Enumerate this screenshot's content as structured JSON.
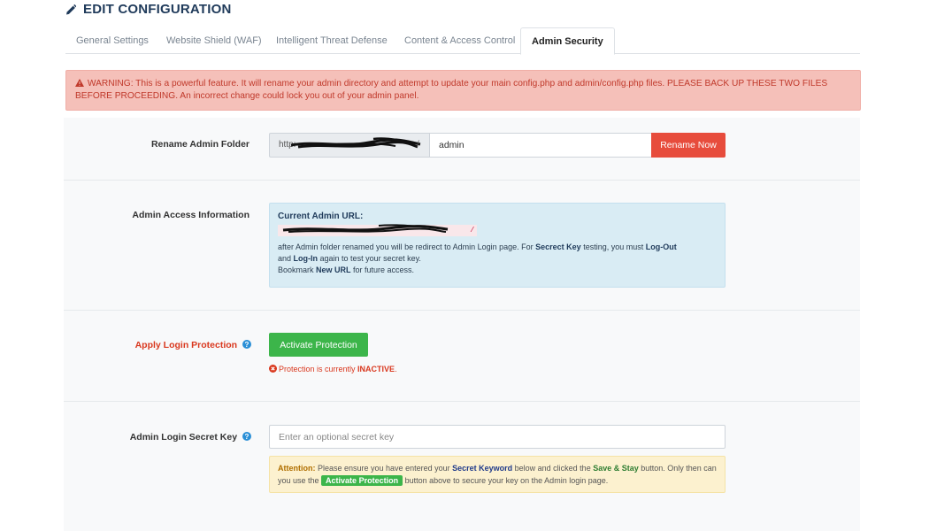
{
  "header": {
    "title": "EDIT CONFIGURATION",
    "icon": "pencil-icon"
  },
  "tabs": [
    {
      "label": "General Settings",
      "active": false
    },
    {
      "label": "Website Shield (WAF)",
      "active": false
    },
    {
      "label": "Intelligent Threat Defense",
      "active": false
    },
    {
      "label": "Content & Access Control",
      "active": false
    },
    {
      "label": "Admin Security",
      "active": true
    }
  ],
  "warning": {
    "text": "WARNING: This is a powerful feature. It will rename your admin directory and attempt to update your main config.php and admin/config.php files. PLEASE BACK UP THESE TWO FILES BEFORE PROCEEDING. An incorrect change could lock you out of your admin panel."
  },
  "rename_folder": {
    "label": "Rename Admin Folder",
    "url_prefix": "http:",
    "url_suffix": "/",
    "input_value": "admin",
    "button_label": "Rename Now"
  },
  "access_info": {
    "label": "Admin Access Information",
    "title": "Current Admin URL:",
    "url_tail": "/",
    "line1_a": "after Admin folder renamed you will be redirect to Admin Login page. For ",
    "line1_b": "Secrect Key",
    "line1_c": " testing, you must ",
    "line1_d": "Log-Out",
    "line2_a": "and ",
    "line2_b": "Log-In",
    "line2_c": " again to test your secret key.",
    "line3_a": "Bookmark ",
    "line3_b": "New URL",
    "line3_c": " for future access."
  },
  "login_protection": {
    "label": "Apply Login Protection",
    "button_label": "Activate Protection",
    "status_prefix": "Protection is currently ",
    "status_value": "INACTIVE",
    "status_suffix": "."
  },
  "secret_key": {
    "label": "Admin Login Secret Key",
    "placeholder": "Enter an optional secret key",
    "att_label": "Attention:",
    "att_1": " Please ensure you have entered your ",
    "att_keyword": "Secret Keyword",
    "att_2": " below and clicked the ",
    "att_save": "Save & Stay",
    "att_3": " button. Only then can you use the ",
    "att_badge": "Activate Protection",
    "att_4": " button above to secure your key on the Admin login page."
  },
  "colors": {
    "danger": "#e74c3c",
    "success": "#3cb54a",
    "info_bg": "#d9ecf4",
    "warning_bg": "#f5c0b9",
    "attention_bg": "#fcf1cf"
  }
}
